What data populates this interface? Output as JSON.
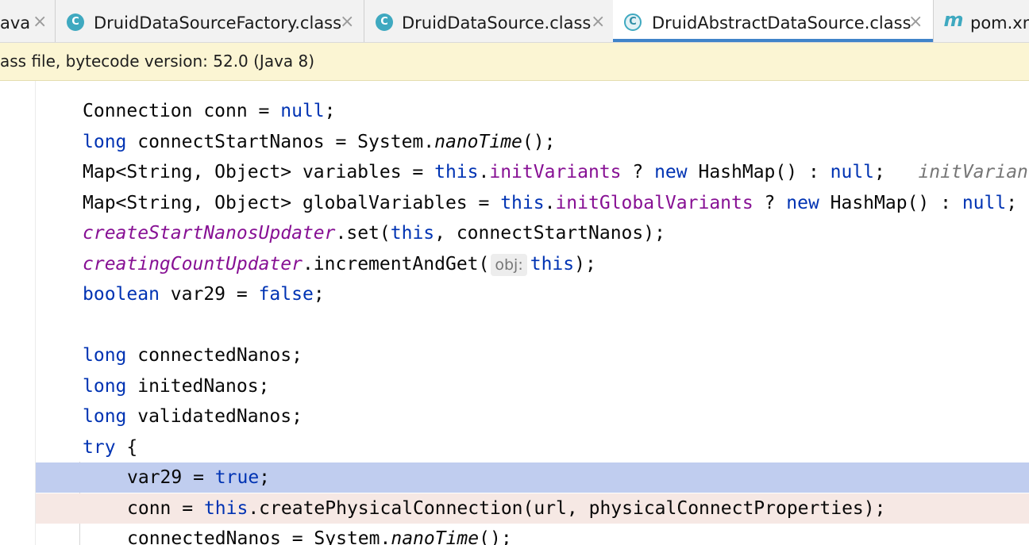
{
  "tabs": [
    {
      "label": "ava",
      "active": false,
      "icon": "none"
    },
    {
      "label": "DruidDataSourceFactory.class",
      "active": false,
      "icon": "class-icon"
    },
    {
      "label": "DruidDataSource.class",
      "active": false,
      "icon": "class-icon"
    },
    {
      "label": "DruidAbstractDataSource.class",
      "active": true,
      "icon": "abstract-class-icon"
    },
    {
      "label": "pom.xml",
      "active": false,
      "icon": "maven-icon"
    }
  ],
  "tab_close_glyph": "×",
  "icon_glyphs": {
    "class": "C",
    "maven": "m"
  },
  "banner": {
    "text": "ass file, bytecode version: 52.0 (Java 8)"
  },
  "code": {
    "l1": {
      "a": "Connection conn = ",
      "null": "null",
      "end": ";"
    },
    "l2": {
      "long": "long",
      "a": " connectStartNanos = System.",
      "m": "nanoTime",
      "end": "();"
    },
    "l3": {
      "a": "Map<String, Object> variables = ",
      "this": "this",
      "dot": ".",
      "f": "initVariants",
      "q": " ? ",
      "new": "new",
      "b": " HashMap() : ",
      "null": "null",
      "end": ";",
      "hint": "initVarian"
    },
    "l4": {
      "a": "Map<String, Object> globalVariables = ",
      "this": "this",
      "dot": ".",
      "f": "initGlobalVariants",
      "q": " ? ",
      "new": "new",
      "b": " HashMap() : ",
      "null": "null",
      "end": ";"
    },
    "l5": {
      "f": "createStartNanosUpdater",
      "a": ".set(",
      "this": "this",
      "end": ", connectStartNanos);"
    },
    "l6": {
      "f": "creatingCountUpdater",
      "a": ".incrementAndGet(",
      "hint": "obj:",
      "this": "this",
      "end": ");"
    },
    "l7": {
      "kw": "boolean",
      "a": " var29 = ",
      "val": "false",
      "end": ";"
    },
    "l9": {
      "long": "long",
      "a": " connectedNanos;"
    },
    "l10": {
      "long": "long",
      "a": " initedNanos;"
    },
    "l11": {
      "long": "long",
      "a": " validatedNanos;"
    },
    "l12": {
      "kw": "try",
      "a": " {"
    },
    "l13": {
      "a": "var29 = ",
      "val": "true",
      "end": ";"
    },
    "l14": {
      "a": "conn = ",
      "this": "this",
      "end": ".createPhysicalConnection(url, physicalConnectProperties);"
    },
    "l15": {
      "a": "connectedNanos = System.",
      "m": "nanoTime",
      "end": "();"
    }
  },
  "colors": {
    "keyword": "#0033b3",
    "field": "#871094",
    "execution_line": "#c0cdef",
    "breakpoint_line": "#f6e8e4",
    "banner": "#fbf5d3",
    "active_tab_underline": "#4083c9"
  }
}
